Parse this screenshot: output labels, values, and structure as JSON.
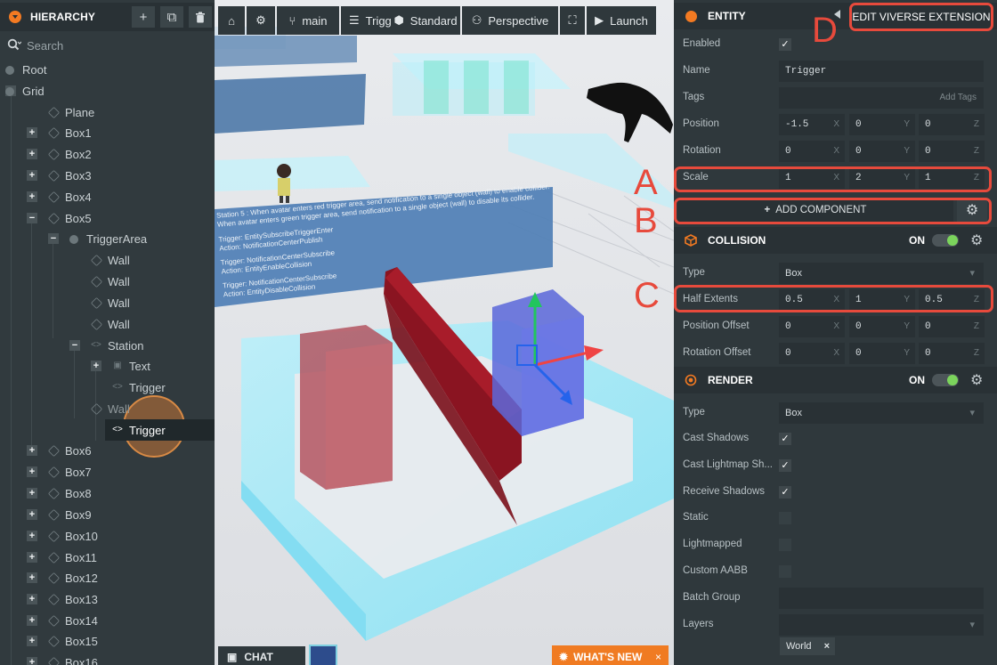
{
  "hierarchy": {
    "title": "HIERARCHY",
    "add_label": "+",
    "duplicate_label": "⧉",
    "delete_label": "🗑",
    "search_placeholder": "Search",
    "items": [
      {
        "label": "Root",
        "icon": "entity-dot-icon",
        "expand": ""
      },
      {
        "label": "Grid",
        "icon": "entity-dot-icon",
        "expand": "−"
      },
      {
        "label": "Plane",
        "icon": "model-icon",
        "expand": ""
      },
      {
        "label": "Box1",
        "icon": "model-icon",
        "expand": "+"
      },
      {
        "label": "Box2",
        "icon": "model-icon",
        "expand": "+"
      },
      {
        "label": "Box3",
        "icon": "model-icon",
        "expand": "+"
      },
      {
        "label": "Box4",
        "icon": "model-icon",
        "expand": "+"
      },
      {
        "label": "Box5",
        "icon": "model-icon",
        "expand": "−"
      },
      {
        "label": "TriggerArea",
        "icon": "entity-dot-icon",
        "expand": "−"
      },
      {
        "label": "Wall",
        "icon": "model-icon",
        "expand": ""
      },
      {
        "label": "Wall",
        "icon": "model-icon",
        "expand": ""
      },
      {
        "label": "Wall",
        "icon": "model-icon",
        "expand": ""
      },
      {
        "label": "Wall",
        "icon": "model-icon",
        "expand": ""
      },
      {
        "label": "Station",
        "icon": "script-icon",
        "expand": "−"
      },
      {
        "label": "Text",
        "icon": "element-icon",
        "expand": "+"
      },
      {
        "label": "Trigger",
        "icon": "script-icon",
        "expand": ""
      },
      {
        "label": "Wall",
        "icon": "model-icon",
        "expand": ""
      },
      {
        "label": "Trigger",
        "icon": "script-icon",
        "expand": ""
      },
      {
        "label": "Box6",
        "icon": "model-icon",
        "expand": "+"
      },
      {
        "label": "Box7",
        "icon": "model-icon",
        "expand": "+"
      },
      {
        "label": "Box8",
        "icon": "model-icon",
        "expand": "+"
      },
      {
        "label": "Box9",
        "icon": "model-icon",
        "expand": "+"
      },
      {
        "label": "Box10",
        "icon": "model-icon",
        "expand": "+"
      },
      {
        "label": "Box11",
        "icon": "model-icon",
        "expand": "+"
      },
      {
        "label": "Box12",
        "icon": "model-icon",
        "expand": "+"
      },
      {
        "label": "Box13",
        "icon": "model-icon",
        "expand": "+"
      },
      {
        "label": "Box14",
        "icon": "model-icon",
        "expand": "+"
      },
      {
        "label": "Box15",
        "icon": "model-icon",
        "expand": "+"
      },
      {
        "label": "Box16",
        "icon": "model-icon",
        "expand": "+"
      }
    ]
  },
  "toolbar": {
    "branch": "main",
    "scene": "Trigger",
    "render_mode": "Standard",
    "camera": "Perspective",
    "launch": "Launch"
  },
  "viewport": {
    "scene_text_lines": [
      "Station 5 : When avatar enters red trigger area, send notification to a single object (wall) to enable collider.",
      "When avatar enters green trigger area, send notification to a single object (wall) to disable its collider.",
      "Trigger: EntitySubscribeTriggerEnter",
      "Action: NotificationCenterPublish",
      "Trigger: NotificationCenterSubscribe",
      "Action: EntityEnableCollision",
      "Trigger: NotificationCenterSubscribe",
      "Action: EntityDisableCollision"
    ],
    "chat_label": "CHAT",
    "whats_new_label": "WHAT'S NEW",
    "whats_new_close": "×"
  },
  "inspector": {
    "entity": {
      "title": "ENTITY",
      "edit_extension_label": "EDIT VIVERSE EXTENSION",
      "enabled_label": "Enabled",
      "enabled": true,
      "name_label": "Name",
      "name_value": "Trigger",
      "tags_label": "Tags",
      "tags_placeholder": "Add Tags",
      "position_label": "Position",
      "position": [
        "-1.5",
        "0",
        "0"
      ],
      "rotation_label": "Rotation",
      "rotation": [
        "0",
        "0",
        "0"
      ],
      "scale_label": "Scale",
      "scale": [
        "1",
        "2",
        "1"
      ],
      "axes": [
        "X",
        "Y",
        "Z"
      ]
    },
    "add_component_label": "ADD COMPONENT",
    "collision": {
      "title": "COLLISION",
      "on_label": "ON",
      "type_label": "Type",
      "type_value": "Box",
      "half_extents_label": "Half Extents",
      "half_extents": [
        "0.5",
        "1",
        "0.5"
      ],
      "position_offset_label": "Position Offset",
      "position_offset": [
        "0",
        "0",
        "0"
      ],
      "rotation_offset_label": "Rotation Offset",
      "rotation_offset": [
        "0",
        "0",
        "0"
      ]
    },
    "render": {
      "title": "RENDER",
      "on_label": "ON",
      "type_label": "Type",
      "type_value": "Box",
      "cast_shadows_label": "Cast Shadows",
      "cast_lightmap_label": "Cast Lightmap Sh...",
      "receive_shadows_label": "Receive Shadows",
      "static_label": "Static",
      "lightmapped_label": "Lightmapped",
      "custom_aabb_label": "Custom AABB",
      "batch_group_label": "Batch Group",
      "layers_label": "Layers",
      "layer_tag": "World",
      "layer_tag_remove": "×"
    }
  },
  "annotations": {
    "a": "A",
    "b": "B",
    "c": "C",
    "d": "D"
  },
  "colors": {
    "accent": "#f37a22",
    "annotation": "#e74a3c",
    "toggle_on": "#7bd45c"
  }
}
